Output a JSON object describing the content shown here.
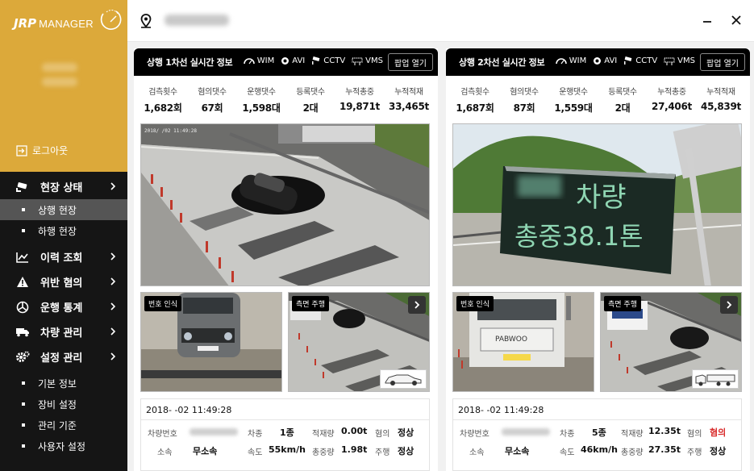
{
  "app": {
    "logo_mark": "JRP",
    "logo_text": "MANAGER"
  },
  "sidebar": {
    "logout_label": "로그아웃",
    "menu": [
      {
        "label": "현장 상태",
        "icon": "cctv-icon"
      },
      {
        "label": "이력 조회",
        "icon": "chart-line-icon"
      },
      {
        "label": "위반 혐의",
        "icon": "warning-icon"
      },
      {
        "label": "운행 통계",
        "icon": "stats-icon"
      },
      {
        "label": "차량 관리",
        "icon": "truck-icon"
      },
      {
        "label": "설정 관리",
        "icon": "gear-icon"
      }
    ],
    "submenu_status": [
      "상행 현장",
      "하행 현장"
    ],
    "submenu_settings": [
      "기본 정보",
      "장비 설정",
      "관리 기준",
      "사용자 설정"
    ]
  },
  "topbar": {
    "minimize_symbol": "−",
    "close_symbol": "✕"
  },
  "panels": [
    {
      "title": "상행 1차선 실시간 정보",
      "badges": [
        "WIM",
        "AVI",
        "CCTV",
        "VMS"
      ],
      "popup_label": "팝업 열기",
      "stats": [
        {
          "label": "검측횟수",
          "value": "1,682회"
        },
        {
          "label": "혐의댓수",
          "value": "67회"
        },
        {
          "label": "운행댓수",
          "value": "1,598대"
        },
        {
          "label": "등록댓수",
          "value": "2대"
        },
        {
          "label": "누적총중",
          "value": "19,871t"
        },
        {
          "label": "누적적재",
          "value": "33,465t"
        }
      ],
      "cam_labels": [
        "번호 인식",
        "측면 주행"
      ],
      "timestamp": "2018-   -02 11:49:28",
      "fields": {
        "plate_label": "차량번호",
        "type_label": "차종",
        "type_value": "1종",
        "load_label": "적재량",
        "load_value": "0.00t",
        "suspect_label": "혐의",
        "suspect_value": "정상",
        "owner_label": "소속",
        "owner_value": "무소속",
        "speed_label": "속도",
        "speed_value": "55km/h",
        "gross_label": "총중량",
        "gross_value": "1.98t",
        "drive_label": "주행",
        "drive_value": "정상"
      }
    },
    {
      "title": "상행 2차선 실시간 정보",
      "badges": [
        "WIM",
        "AVI",
        "CCTV",
        "VMS"
      ],
      "popup_label": "팝업 열기",
      "stats": [
        {
          "label": "검측횟수",
          "value": "1,687회"
        },
        {
          "label": "혐의댓수",
          "value": "87회"
        },
        {
          "label": "운행댓수",
          "value": "1,559대"
        },
        {
          "label": "등록댓수",
          "value": "2대"
        },
        {
          "label": "누적총중",
          "value": "27,406t"
        },
        {
          "label": "누적적재",
          "value": "45,839t"
        }
      ],
      "vms_text_line1": "차량",
      "vms_text_line2": "총중38.1톤",
      "cam_labels": [
        "번호 인식",
        "측면 주행"
      ],
      "truck_plate": "PABWOO",
      "timestamp": "2018-   -02 11:49:28",
      "fields": {
        "plate_label": "차량번호",
        "type_label": "차종",
        "type_value": "5종",
        "load_label": "적재량",
        "load_value": "12.35t",
        "suspect_label": "혐의",
        "suspect_value": "혐의",
        "owner_label": "소속",
        "owner_value": "무소속",
        "speed_label": "속도",
        "speed_value": "46km/h",
        "gross_label": "총중량",
        "gross_value": "27.35t",
        "drive_label": "주행",
        "drive_value": "정상"
      }
    }
  ],
  "colors": {
    "sidebar_gold": "#dca93a",
    "sidebar_dark": "#151515",
    "suspect_red": "#d82a2a"
  }
}
